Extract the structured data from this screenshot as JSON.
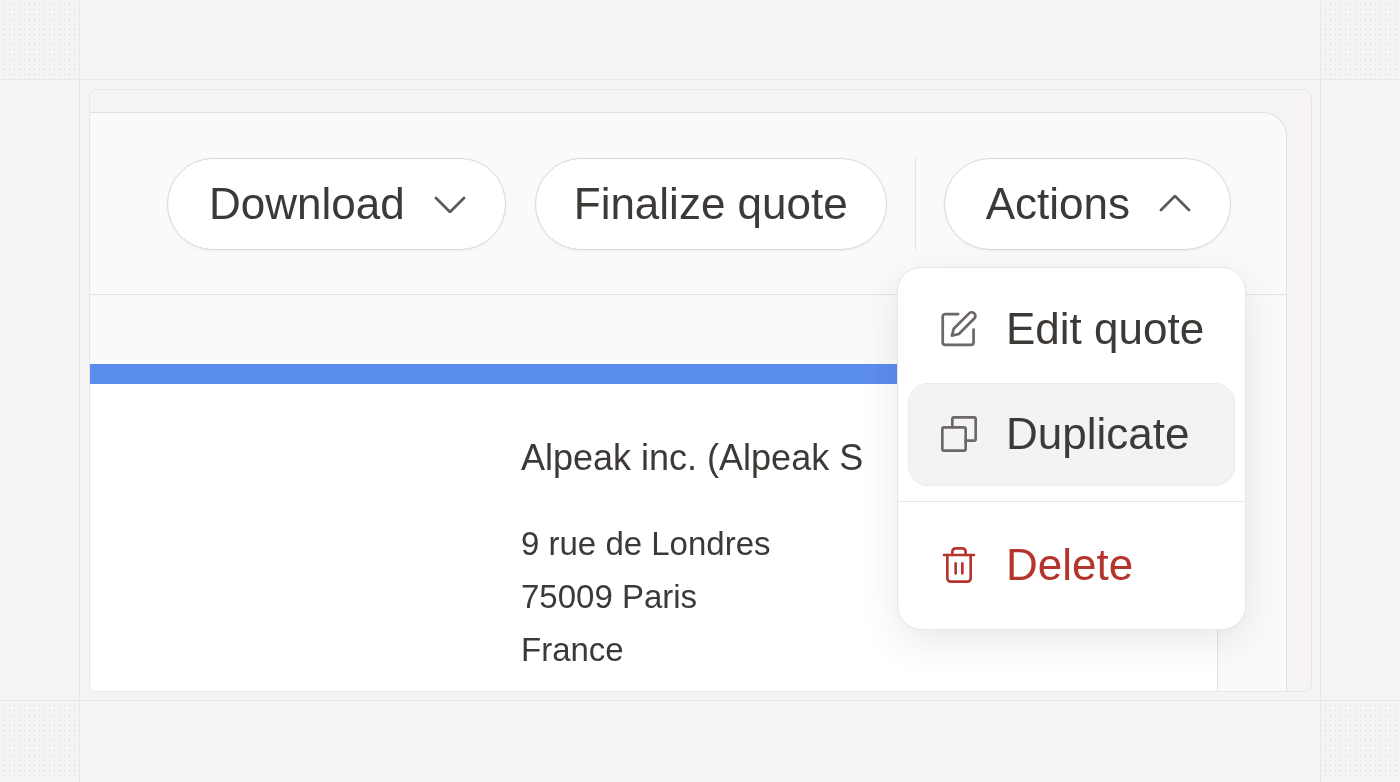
{
  "toolbar": {
    "groups": [
      {
        "buttons": [
          {
            "label": "Download",
            "kind": "dropdown",
            "expanded": false
          },
          {
            "label": "Finalize quote",
            "kind": "button"
          }
        ]
      },
      {
        "buttons": [
          {
            "label": "Actions",
            "kind": "dropdown",
            "expanded": true,
            "menu": {
              "groups": [
                {
                  "items": [
                    {
                      "label": "Edit quote",
                      "kind": "edit",
                      "selected": false
                    },
                    {
                      "label": "Duplicate",
                      "kind": "duplicate",
                      "selected": true
                    }
                  ]
                },
                {
                  "items": [
                    {
                      "label": "Delete",
                      "kind": "delete",
                      "selected": false
                    }
                  ]
                }
              ]
            }
          }
        ]
      }
    ]
  },
  "document": {
    "customer_name": "Alpeak inc. (Alpeak S",
    "address_lines": [
      "9 rue de Londres",
      "75009 Paris",
      "France"
    ]
  }
}
